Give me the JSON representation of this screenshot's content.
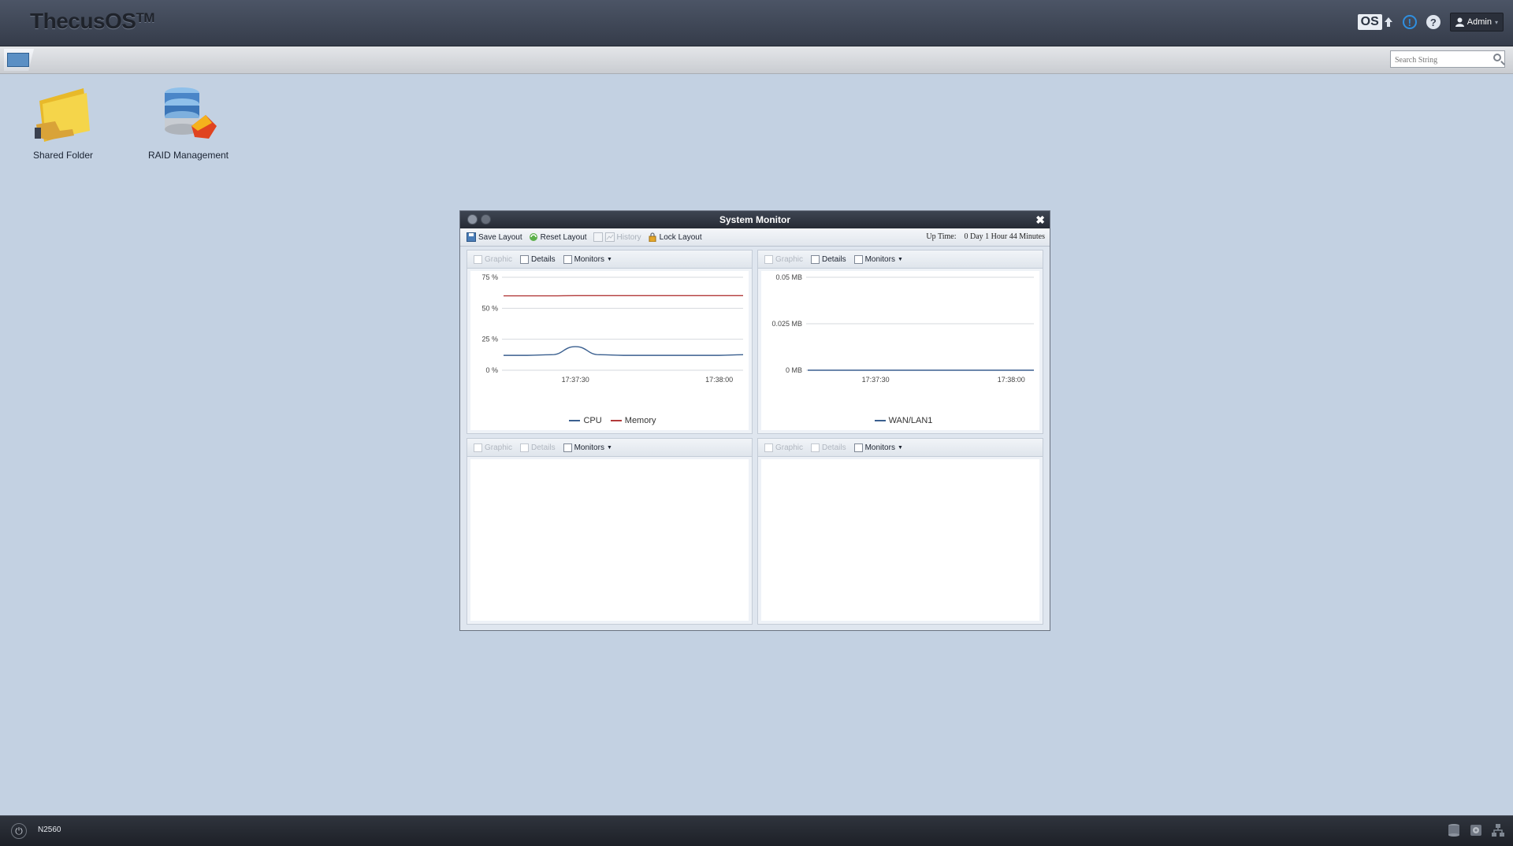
{
  "app": {
    "logo_text": "ThecusOS",
    "logo_sup": "TM"
  },
  "topbar": {
    "os_label": "OS",
    "admin_label": "Admin"
  },
  "search": {
    "placeholder": "Search String"
  },
  "desktop_icons": [
    {
      "label": "Shared Folder",
      "icon": "shared-folder-icon"
    },
    {
      "label": "RAID Management",
      "icon": "raid-management-icon"
    }
  ],
  "window": {
    "title": "System Monitor",
    "toolbar": {
      "save_layout": "Save Layout",
      "reset_layout": "Reset Layout",
      "history": "History",
      "lock_layout": "Lock Layout",
      "uptime_label": "Up Time:",
      "uptime_value": "0 Day 1 Hour 44 Minutes"
    },
    "panels": [
      {
        "graphic": "Graphic",
        "details": "Details",
        "monitors": "Monitors"
      },
      {
        "graphic": "Graphic",
        "details": "Details",
        "monitors": "Monitors"
      },
      {
        "graphic": "Graphic",
        "details": "Details",
        "monitors": "Monitors"
      },
      {
        "graphic": "Graphic",
        "details": "Details",
        "monitors": "Monitors"
      }
    ]
  },
  "chart_data": [
    {
      "type": "line",
      "x": [
        "17:37:15",
        "17:37:20",
        "17:37:25",
        "17:37:30",
        "17:37:35",
        "17:37:40",
        "17:37:45",
        "17:37:50",
        "17:37:55",
        "17:38:00",
        "17:38:05"
      ],
      "x_ticks": [
        "17:37:30",
        "17:38:00"
      ],
      "y_ticks": [
        "0 %",
        "25 %",
        "50 %",
        "75 %"
      ],
      "ylim": [
        0,
        75
      ],
      "grid": true,
      "legend": "bottom",
      "series": [
        {
          "name": "CPU",
          "color": "#3a5f8f",
          "values": [
            12,
            12,
            12.5,
            19,
            12.5,
            12,
            12,
            12,
            12,
            12,
            12.5
          ]
        },
        {
          "name": "Memory",
          "color": "#b23a3a",
          "values": [
            60,
            60,
            60,
            60.2,
            60.2,
            60.2,
            60.2,
            60.2,
            60.2,
            60.2,
            60.2
          ]
        }
      ]
    },
    {
      "type": "line",
      "x": [
        "17:37:15",
        "17:37:20",
        "17:37:25",
        "17:37:30",
        "17:37:35",
        "17:37:40",
        "17:37:45",
        "17:37:50",
        "17:37:55",
        "17:38:00",
        "17:38:05"
      ],
      "x_ticks": [
        "17:37:30",
        "17:38:00"
      ],
      "y_ticks": [
        "0 MB",
        "0.025 MB",
        "0.05 MB"
      ],
      "ylim": [
        0,
        0.05
      ],
      "grid": true,
      "legend": "bottom",
      "series": [
        {
          "name": "WAN/LAN1",
          "color": "#3a5f8f",
          "values": [
            0,
            0,
            0,
            0,
            0,
            0,
            0,
            0,
            0,
            0,
            0
          ]
        }
      ]
    }
  ],
  "bottombar": {
    "hostname": "N2560"
  },
  "colors": {
    "desktop_bg": "#c3d1e2",
    "cpu_line": "#3a5f8f",
    "memory_line": "#b23a3a"
  }
}
